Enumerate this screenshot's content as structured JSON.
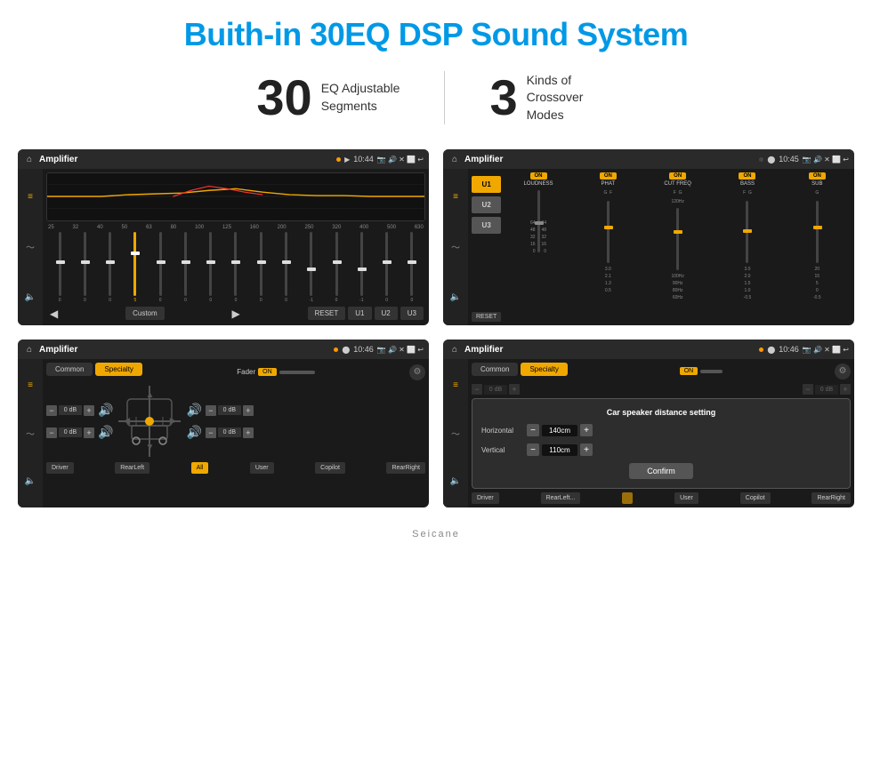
{
  "header": {
    "title": "Buith-in 30EQ DSP Sound System"
  },
  "stats": {
    "eq_number": "30",
    "eq_desc_line1": "EQ Adjustable",
    "eq_desc_line2": "Segments",
    "crossover_number": "3",
    "crossover_desc_line1": "Kinds of",
    "crossover_desc_line2": "Crossover Modes"
  },
  "screen1": {
    "title": "Amplifier",
    "time": "10:44",
    "freq_labels": [
      "25",
      "32",
      "40",
      "50",
      "63",
      "80",
      "100",
      "125",
      "160",
      "200",
      "250",
      "320",
      "400",
      "500",
      "630"
    ],
    "slider_values": [
      "0",
      "0",
      "0",
      "5",
      "0",
      "0",
      "0",
      "0",
      "0",
      "0",
      "-1",
      "0",
      "-1"
    ],
    "preset": "Custom",
    "buttons": [
      "RESET",
      "U1",
      "U2",
      "U3"
    ]
  },
  "screen2": {
    "title": "Amplifier",
    "time": "10:45",
    "channels": [
      "U1",
      "U2",
      "U3"
    ],
    "on_labels": [
      "ON",
      "ON",
      "ON",
      "ON",
      "ON"
    ],
    "channel_labels": [
      "LOUDNESS",
      "PHAT",
      "CUT FREQ",
      "BASS",
      "SUB"
    ],
    "reset_label": "RESET"
  },
  "screen3": {
    "title": "Amplifier",
    "time": "10:46",
    "tabs": [
      "Common",
      "Specialty"
    ],
    "active_tab": "Specialty",
    "fader_label": "Fader",
    "fader_toggle": "ON",
    "db_values": [
      "0 dB",
      "0 dB",
      "0 dB",
      "0 dB"
    ],
    "bottom_buttons": [
      "Driver",
      "RearLeft",
      "All",
      "User",
      "Copilot",
      "RearRight"
    ]
  },
  "screen4": {
    "title": "Amplifier",
    "time": "10:46",
    "tabs": [
      "Common",
      "Specialty"
    ],
    "dialog_title": "Car speaker distance setting",
    "horizontal_label": "Horizontal",
    "horizontal_value": "140cm",
    "vertical_label": "Vertical",
    "vertical_value": "110cm",
    "confirm_label": "Confirm",
    "db_values": [
      "0 dB",
      "0 dB"
    ],
    "bottom_buttons": [
      "Driver",
      "RearLeft...",
      "Copilot",
      "RearRight"
    ]
  },
  "watermark": "Seicane"
}
